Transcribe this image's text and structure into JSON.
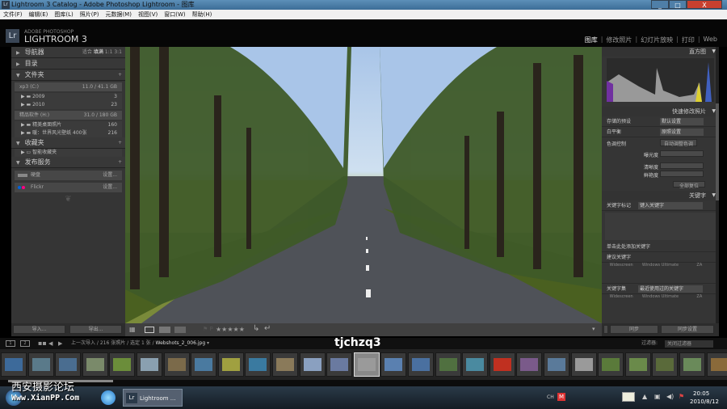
{
  "window": {
    "title": "Lightroom 3 Catalog - Adobe Photoshop Lightroom - 图库",
    "min": "_",
    "max": "□",
    "close": "X"
  },
  "menu": [
    "文件(F)",
    "编辑(E)",
    "图库(L)",
    "照片(P)",
    "元数据(M)",
    "视图(V)",
    "窗口(W)",
    "帮助(H)"
  ],
  "logo": {
    "badge": "Lr",
    "sub": "ADOBE PHOTOSHOP",
    "main": "LIGHTROOM 3"
  },
  "modules": [
    "图库",
    "修改照片",
    "幻灯片放映",
    "打印",
    "Web"
  ],
  "left": {
    "navigator": {
      "title": "导航器",
      "zoom": [
        "适合",
        "填满",
        "1:1",
        "3:1"
      ]
    },
    "catalog": "目录",
    "folders": {
      "title": "文件夹",
      "volumes": [
        {
          "name": "xp3 (C:)",
          "space": "11.0 / 41.1 GB",
          "items": [
            {
              "name": "2009",
              "count": "3"
            },
            {
              "name": "2010",
              "count": "23"
            }
          ]
        },
        {
          "name": "精品软件 (H:)",
          "space": "31.0 / 180 GB",
          "items": [
            {
              "name": "精美桌面照片",
              "count": "160"
            },
            {
              "name": "暖：世界风光壁纸 400张",
              "count": "216"
            }
          ]
        }
      ]
    },
    "collections": {
      "title": "收藏夹",
      "items": [
        "智能收藏夹"
      ]
    },
    "publish": {
      "title": "发布服务",
      "items": [
        {
          "name": "硬盘",
          "action": "设置..."
        },
        {
          "name": "Flickr",
          "action": "设置..."
        }
      ]
    },
    "import": "导入...",
    "export": "导出..."
  },
  "right": {
    "histogram": "直方图",
    "quick": {
      "title": "快速修改照片",
      "saved_preset": "存储的预设",
      "saved_value": "默认设置",
      "wb": "白平衡",
      "wb_value": "原照设置",
      "tone": "色调控制",
      "auto_tone": "自动调整色调",
      "exposure": "曝光度",
      "clarity": "清晰度",
      "vibrance": "鲜艳度",
      "reset": "全部复位"
    },
    "keywords": {
      "title": "关键字",
      "tagging": "关键字标记",
      "input": "键入关键字",
      "hint": "单击此处添加关键字",
      "suggest": "建议关键字",
      "sugg_items": [
        "Widescreen",
        "Windows Ultimate",
        "ZA"
      ],
      "set": "关键字集",
      "set_value": "最近使用过的关键字",
      "set_items": [
        "Widescreen",
        "Windows Ultimate",
        "ZA"
      ]
    },
    "sync": "同步",
    "sync_settings": "同步设置"
  },
  "filmbar": {
    "path": "上一次导入 / 216 张照片 / 选定 1 张 /",
    "file": "Webshots_2_006.jpg",
    "filter_label": "过滤器:",
    "filter_value": "关闭过滤器"
  },
  "watermark": "tjchzq3",
  "forum": {
    "name": "西安摄影论坛",
    "url": "Www.XianPP.Com"
  },
  "taskbar": {
    "app": "Lightroom ...",
    "lang": "CH",
    "time": "20:05",
    "date": "2010/8/12"
  },
  "stars": "★★★★★",
  "thumb_colors": [
    "#3d6a9a",
    "#5a7a8a",
    "#4a6d90",
    "#7a8a6a",
    "#6b8d3a",
    "#8aa0b0",
    "#7b6a4a",
    "#4a7aa0",
    "#a0a040",
    "#3a7aa0",
    "#8a7a5a",
    "#8aa0c0",
    "#6a7aa0",
    "#9a9a9a",
    "#5a80b0",
    "#4a70a0",
    "#507040",
    "#4a8aa0",
    "#c03020",
    "#7a5a8a",
    "#5a7a9a",
    "#9a9a9a",
    "#5a7a3a",
    "#6a8a4a",
    "#5a6a3a",
    "#6a8a5a",
    "#8a6a3a"
  ]
}
